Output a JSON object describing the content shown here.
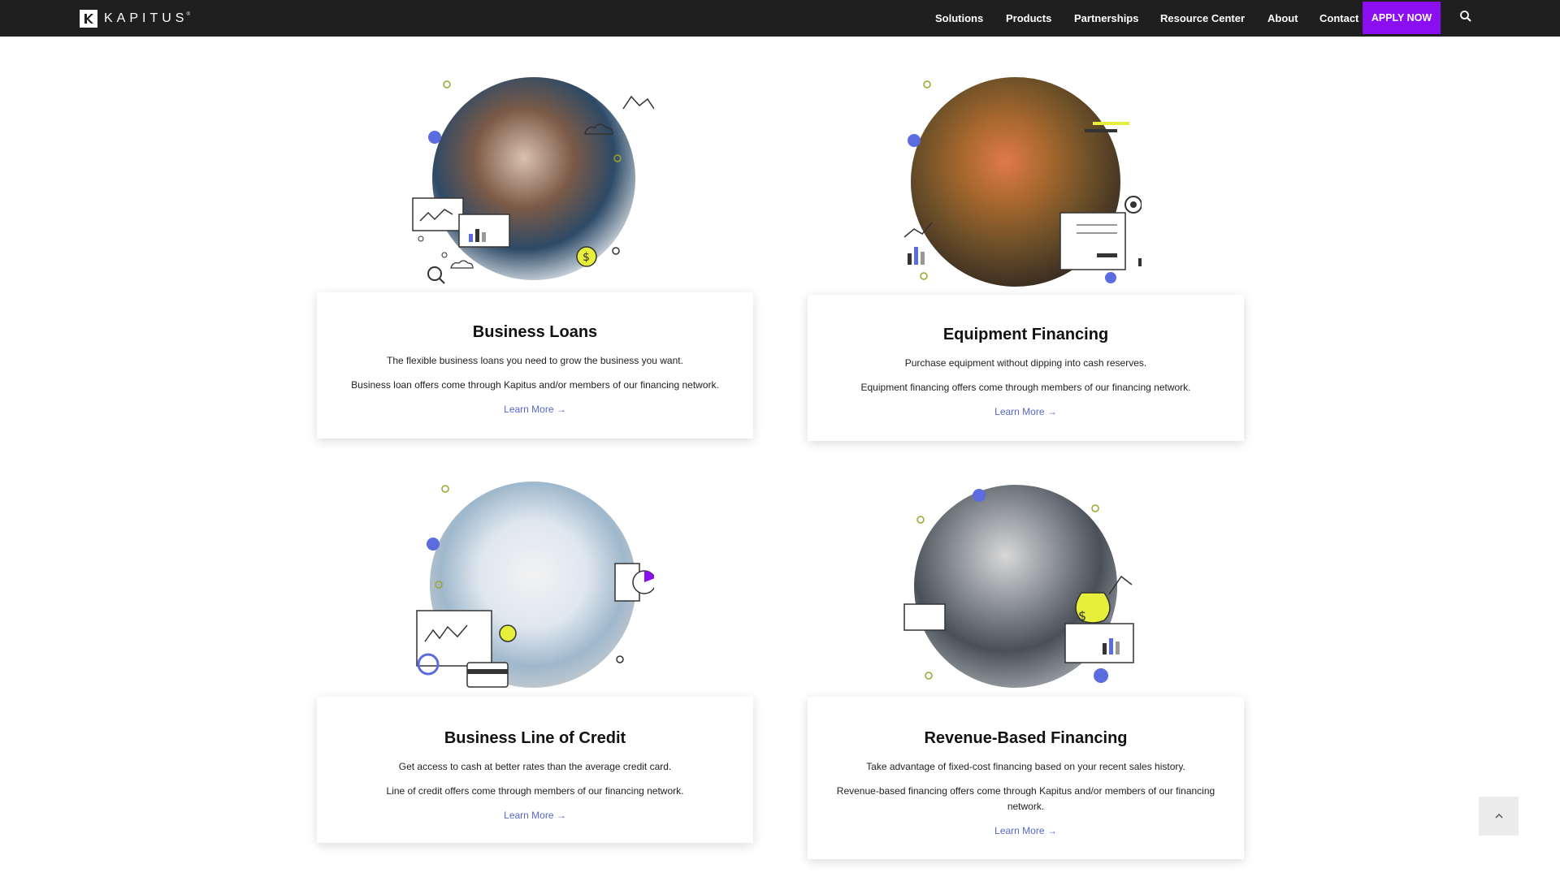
{
  "brand": {
    "name": "KAPITUS",
    "tm": "®"
  },
  "nav": {
    "items": [
      "Solutions",
      "Products",
      "Partnerships",
      "Resource Center",
      "About",
      "Contact"
    ],
    "apply_label": "APPLY NOW"
  },
  "colors": {
    "nav_bg": "#1f1f1f",
    "accent": "#8a0ef0",
    "link": "#5468c8",
    "dot_blue": "#5b6ce0",
    "dot_yellow": "#e6ef3a"
  },
  "icons": {
    "search": "search-icon",
    "scroll_top": "chevron-up-icon"
  },
  "products": [
    {
      "title": "Business Loans",
      "line1": "The flexible business loans you need to grow the business you want.",
      "line2": "Business loan offers come through Kapitus and/or members of our financing network.",
      "link": "Learn More →"
    },
    {
      "title": "Equipment Financing",
      "line1": "Purchase equipment without dipping into cash reserves.",
      "line2": "Equipment financing offers come through members of our financing network.",
      "link": "Learn More →"
    },
    {
      "title": "Business Line of Credit",
      "line1": "Get access to cash at better rates than the average credit card.",
      "line2": "Line of credit offers come through members of our financing network.",
      "link": "Learn More →"
    },
    {
      "title": "Revenue-Based Financing",
      "line1": "Take advantage of fixed-cost financing based on your recent sales history.",
      "line2": "Revenue-based financing offers come through Kapitus and/or members of our financing network.",
      "link": "Learn More →"
    }
  ]
}
